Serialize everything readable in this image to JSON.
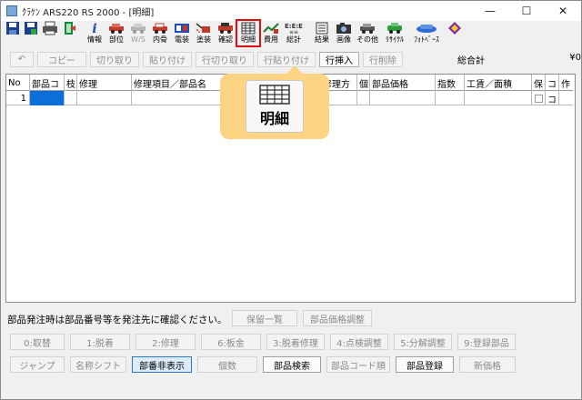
{
  "window": {
    "title": "ｸﾗｹﾝ ARS220 RS 2000 - [明細]",
    "controls": [
      "—",
      "☐",
      "✕"
    ]
  },
  "toolbar": [
    {
      "name": "save",
      "label": "",
      "icon": "save-icon",
      "color": "#1a3f8c"
    },
    {
      "name": "save-as",
      "label": "",
      "icon": "save-as-icon",
      "color": "#1a3f8c"
    },
    {
      "name": "print",
      "label": "",
      "icon": "printer-icon",
      "color": "#333333"
    },
    {
      "name": "exit",
      "label": "",
      "icon": "exit-door-icon",
      "color": "#0f8a3c"
    },
    {
      "name": "info",
      "label": "情報",
      "icon": "info-icon",
      "color": "#1c4fb3"
    },
    {
      "name": "parts",
      "label": "部位",
      "icon": "car-parts-icon",
      "color": "#c0392b"
    },
    {
      "name": "ws",
      "label": "W/S",
      "icon": "ws-icon",
      "color": "#9a9a9a",
      "disabled": true
    },
    {
      "name": "internal-bone",
      "label": "内骨",
      "icon": "car-frame-icon",
      "color": "#c0392b"
    },
    {
      "name": "electrical",
      "label": "電装",
      "icon": "electrical-icon",
      "color": "#c0392b"
    },
    {
      "name": "paint",
      "label": "塗装",
      "icon": "spray-paint-icon",
      "color": "#c0392b"
    },
    {
      "name": "confirm",
      "label": "確認",
      "icon": "confirm-icon",
      "color": "#c0392b"
    },
    {
      "name": "detail",
      "label": "明細",
      "icon": "detail-grid-icon",
      "color": "#333333",
      "highlighted": true
    },
    {
      "name": "expense",
      "label": "費用",
      "icon": "expense-icon",
      "color": "#1a7a2e"
    },
    {
      "name": "summary",
      "label": "総計",
      "icon": "summary-icon",
      "color": "#333333"
    },
    {
      "name": "result",
      "label": "結果",
      "icon": "result-icon",
      "color": "#333333"
    },
    {
      "name": "image",
      "label": "画像",
      "icon": "camera-image-icon",
      "color": "#333333"
    },
    {
      "name": "other",
      "label": "その他",
      "icon": "other-icon",
      "color": "#333333"
    },
    {
      "name": "recycle",
      "label": "ﾘｻｲｸﾙ",
      "icon": "recycle-icon",
      "color": "#2e9c3a"
    },
    {
      "name": "photobase",
      "label": "ﾌｫﾄﾍﾞｰｽ",
      "icon": "photobase-icon",
      "color": "#2d6bd1"
    },
    {
      "name": "book",
      "label": "",
      "icon": "book-icon",
      "color": "#7a2ea1"
    }
  ],
  "editbar": {
    "buttons": [
      {
        "label": "↶",
        "active": false
      },
      {
        "label": "コピー",
        "active": false
      },
      {
        "label": "切り取り",
        "active": false
      },
      {
        "label": "貼り付け",
        "active": false
      },
      {
        "label": "行切り取り",
        "active": false
      },
      {
        "label": "行貼り付け",
        "active": false
      },
      {
        "label": "行挿入",
        "active": true
      },
      {
        "label": "行削除",
        "active": false
      }
    ],
    "total_label": "総合計",
    "total_value": "¥0"
  },
  "grid": {
    "columns": [
      "No",
      "部品コ",
      "枝",
      "修理",
      "修理項目／部品名",
      "",
      "修理方",
      "個",
      "部品価格",
      "指数",
      "工賃／面積",
      "保",
      "コ",
      "作"
    ],
    "rows": [
      {
        "no": "1",
        "ko": "コ"
      }
    ]
  },
  "zoom": {
    "label": "明細"
  },
  "footer": {
    "notice": "部品発注時は部品番号等を発注先に確認ください。",
    "notice_buttons": [
      "保留一覧",
      "部品価格調整"
    ],
    "row1": [
      "0:取替",
      "1:脱着",
      "2:修理",
      "6:板金",
      "3:脱着修理",
      "4:点検調整",
      "5:分解調整",
      "9:登録部品"
    ],
    "row2": [
      "ジャンプ",
      "名称シフト",
      "部番非表示",
      "個数",
      "部品検索",
      "部品コード順",
      "部品登録",
      "新価格"
    ]
  }
}
